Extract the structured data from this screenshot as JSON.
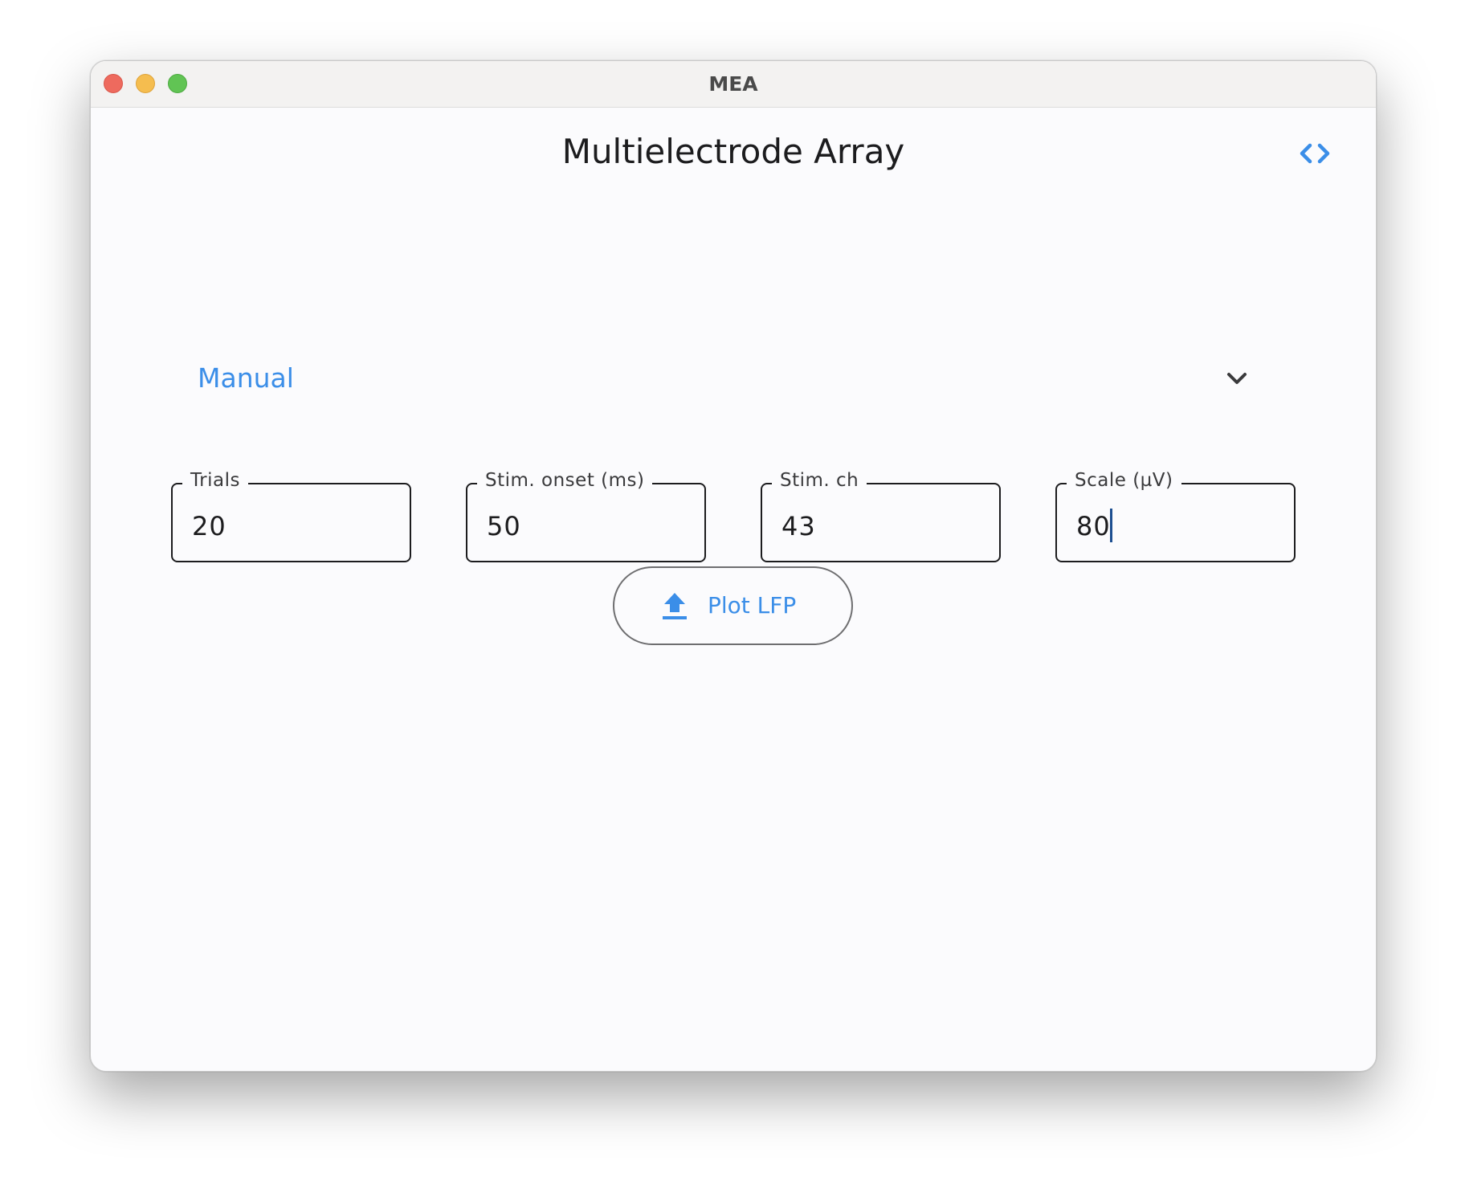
{
  "window": {
    "title": "MEA"
  },
  "header": {
    "title": "Multielectrode Array",
    "code_icon": "code-icon"
  },
  "mode_select": {
    "selected": "Manual",
    "icon": "chevron-down-icon"
  },
  "fields": [
    {
      "label": "Trials",
      "value": "20"
    },
    {
      "label": "Stim. onset (ms)",
      "value": "50"
    },
    {
      "label": "Stim. ch",
      "value": "43"
    },
    {
      "label": "Scale (µV)",
      "value": "80"
    }
  ],
  "plot_button": {
    "label": "Plot LFP",
    "icon": "upload-icon"
  },
  "colors": {
    "accent": "#3b8ee8",
    "text": "#1c1c1e",
    "background": "#fbfbfd",
    "titlebar": "#f3f2f1",
    "close": "#ee6a5e",
    "minimize": "#f5bd4f",
    "maximize": "#61c454"
  }
}
